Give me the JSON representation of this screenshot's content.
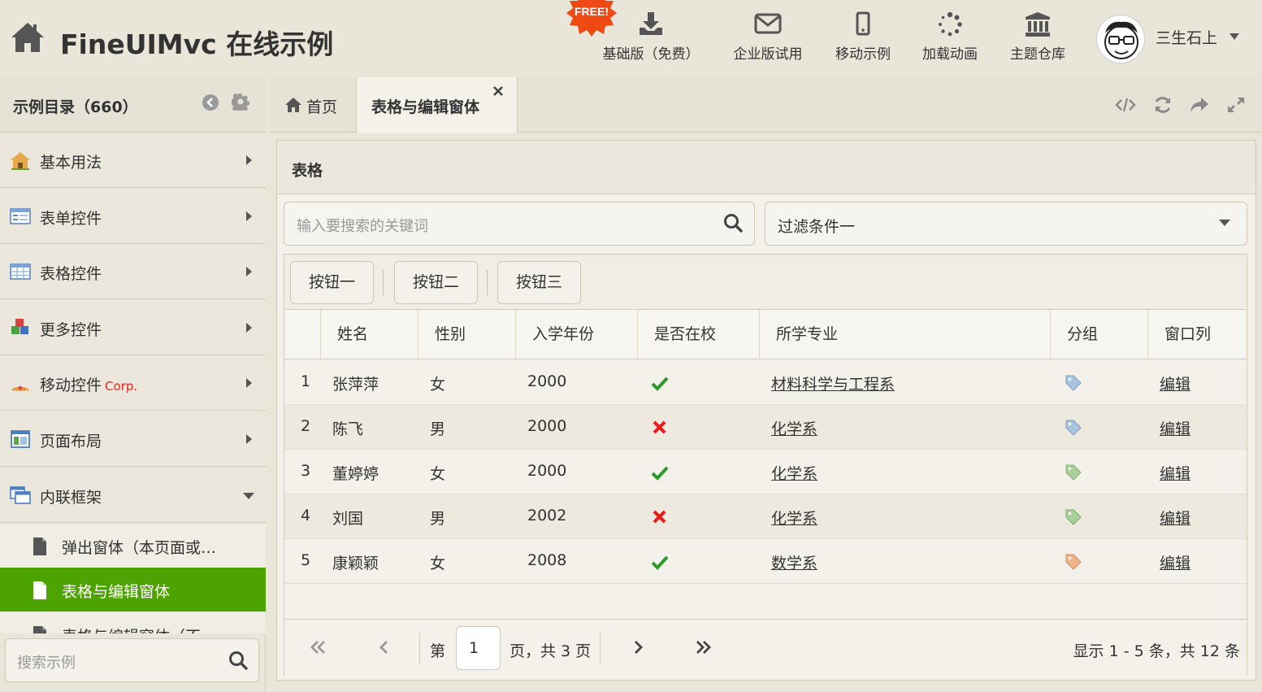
{
  "header": {
    "app_title": "FineUIMvc 在线示例",
    "free_badge": "FREE!",
    "nav": [
      {
        "label": "基础版（免费）",
        "icon": "download-icon"
      },
      {
        "label": "企业版试用",
        "icon": "envelope-icon"
      },
      {
        "label": "移动示例",
        "icon": "mobile-icon"
      },
      {
        "label": "加载动画",
        "icon": "spinner-icon"
      },
      {
        "label": "主题仓库",
        "icon": "bank-icon"
      }
    ],
    "user": {
      "name": "三生石上"
    }
  },
  "sidebar": {
    "title": "示例目录（660）",
    "items": [
      {
        "label": "基本用法",
        "icon": "home-icon"
      },
      {
        "label": "表单控件",
        "icon": "form-icon"
      },
      {
        "label": "表格控件",
        "icon": "table-icon"
      },
      {
        "label": "更多控件",
        "icon": "cubes-icon"
      },
      {
        "label": "移动控件",
        "badge": "Corp.",
        "icon": "rss-icon"
      },
      {
        "label": "页面布局",
        "icon": "layout-icon"
      },
      {
        "label": "内联框架",
        "icon": "window-icon",
        "expanded": true
      }
    ],
    "sub_items": [
      {
        "label": "弹出窗体（本页面或…",
        "active": false
      },
      {
        "label": "表格与编辑窗体",
        "active": true
      },
      {
        "label": "表格与编辑窗体（不",
        "active": false
      }
    ],
    "search_placeholder": "搜索示例"
  },
  "tabs": [
    {
      "label": "首页",
      "icon": "home-icon",
      "active": false
    },
    {
      "label": "表格与编辑窗体",
      "active": true,
      "closable": true
    }
  ],
  "tab_tools": [
    "code-icon",
    "refresh-icon",
    "share-icon",
    "expand-icon"
  ],
  "panel": {
    "title": "表格",
    "search_placeholder": "输入要搜索的关键词",
    "filter_value": "过滤条件一",
    "buttons": [
      "按钮一",
      "按钮二",
      "按钮三"
    ]
  },
  "table": {
    "columns": [
      "姓名",
      "性别",
      "入学年份",
      "是否在校",
      "所学专业",
      "分组",
      "窗口列"
    ],
    "rows": [
      {
        "index": "1",
        "name": "张萍萍",
        "gender": "女",
        "year": "2000",
        "at_school": true,
        "major": "材料科学与工程系",
        "group_color": "#a9c4df",
        "action": "编辑"
      },
      {
        "index": "2",
        "name": "陈飞",
        "gender": "男",
        "year": "2000",
        "at_school": false,
        "major": "化学系",
        "group_color": "#a9c4df",
        "action": "编辑"
      },
      {
        "index": "3",
        "name": "董婷婷",
        "gender": "女",
        "year": "2000",
        "at_school": true,
        "major": "化学系",
        "group_color": "#a9cf9a",
        "action": "编辑"
      },
      {
        "index": "4",
        "name": "刘国",
        "gender": "男",
        "year": "2002",
        "at_school": false,
        "major": "化学系",
        "group_color": "#a9cf9a",
        "action": "编辑"
      },
      {
        "index": "5",
        "name": "康颖颖",
        "gender": "女",
        "year": "2008",
        "at_school": true,
        "major": "数学系",
        "group_color": "#f2b48a",
        "action": "编辑"
      }
    ]
  },
  "pager": {
    "prefix": "第",
    "current_page": "1",
    "suffix": "页，共 3 页",
    "info": "显示 1 - 5 条，共 12 条"
  },
  "colors": {
    "accent_green": "#4da302",
    "check_green": "#2b9a2b",
    "cross_red": "#e31b1b",
    "free_badge": "#f04a14"
  }
}
